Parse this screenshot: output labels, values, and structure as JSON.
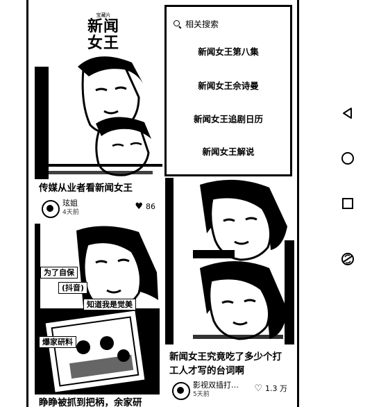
{
  "popover": {
    "header": "相关搜索",
    "items": [
      "新闻女王第八集",
      "新闻女王佘诗曼",
      "新闻女王追剧日历",
      "新闻女王解说"
    ]
  },
  "cards": [
    {
      "title": "传媒从业者看新闻女王",
      "author": "玹姐",
      "time": "4天前",
      "likes": "86",
      "masthead_small": "宝藏片",
      "masthead_line1": "新闻",
      "masthead_line2": "女王"
    },
    {
      "title": "新闻女王究竟吃了多少个打工人才写的台词啊",
      "author": "影视双插打…",
      "time": "5天前",
      "likes": "1.3 万"
    },
    {
      "title": "睁睁被抓到把柄，余家研",
      "caption1": "为了自保",
      "caption2": "(抖音)",
      "caption3": "知道我是觉美",
      "caption4": "爆家研料"
    }
  ],
  "nav": {
    "back_icon": "triangle-back-icon",
    "home_icon": "circle-home-icon",
    "recents_icon": "square-recents-icon",
    "extra_icon": "rotate-icon"
  }
}
